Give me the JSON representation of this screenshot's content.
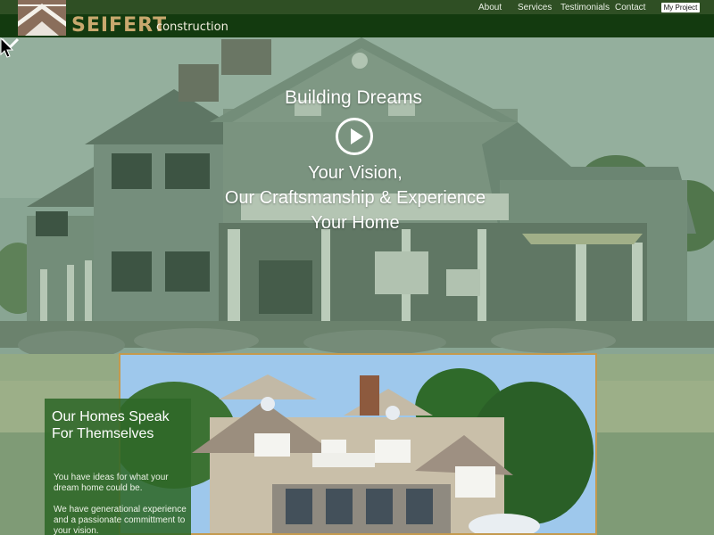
{
  "header": {
    "brand": "SEIFERT",
    "brand_sub": "construction",
    "nav": [
      "About",
      "Services",
      "Testimonials",
      "Contact"
    ],
    "cta": "My Project",
    "colors": {
      "bar": "#2f4f24",
      "bar_dark": "#133a0f",
      "brand": "#c8a86e"
    }
  },
  "hero": {
    "title": "Building Dreams",
    "tagline": [
      "Your Vision,",
      "Our Craftsmanship & Experience",
      "Your Home"
    ],
    "icons": {
      "play": "play-icon",
      "scroll": "chevron-down-icon"
    }
  },
  "intro": {
    "heading": "Our Homes Speak For Themselves",
    "paragraphs": [
      "You have ideas for what your dream home could be.",
      "We have generational experience and a passionate committment to your vision."
    ],
    "colors": {
      "panel": "#2f6828",
      "photo_border": "#c49a4e"
    }
  }
}
